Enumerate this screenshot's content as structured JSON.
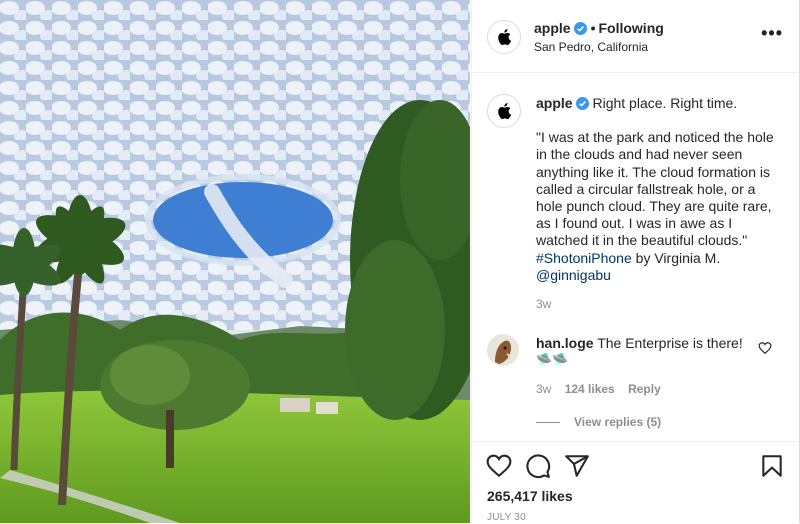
{
  "post": {
    "image_alt": "Park with palm trees under a sky with a circular hole in the clouds",
    "author": {
      "username": "apple",
      "verified": true,
      "separator": "•",
      "follow_status": "Following",
      "location": "San Pedro, California"
    },
    "more_label": "•••",
    "caption": {
      "username": "apple",
      "headline": "Right place. Right time.",
      "body": "\"I was at the park and noticed the hole in the clouds and had never seen anything like it. The cloud formation is called a circular fallstreak hole, or a hole punch cloud. They are quite rare, as I found out. I was in awe as I watched it in the beautiful clouds.\"",
      "hashtag": "#ShotoniPhone",
      "credit_prefix": "by Virginia M.",
      "mention": "@ginnigabu",
      "time": "3w"
    },
    "comment": {
      "username": "han.loge",
      "text": "The Enterprise is there!",
      "emoji": "🛸🛸",
      "time": "3w",
      "likes": "124 likes",
      "reply_label": "Reply",
      "view_replies": "View replies (5)"
    },
    "actions": {
      "like_icon": "heart-icon",
      "comment_icon": "comment-icon",
      "share_icon": "paper-plane-icon",
      "save_icon": "bookmark-icon"
    },
    "likes": "265,417 likes",
    "date": "JULY 30"
  },
  "colors": {
    "verified": "#3897f0",
    "link": "#00376b",
    "muted": "#8e8e8e"
  }
}
